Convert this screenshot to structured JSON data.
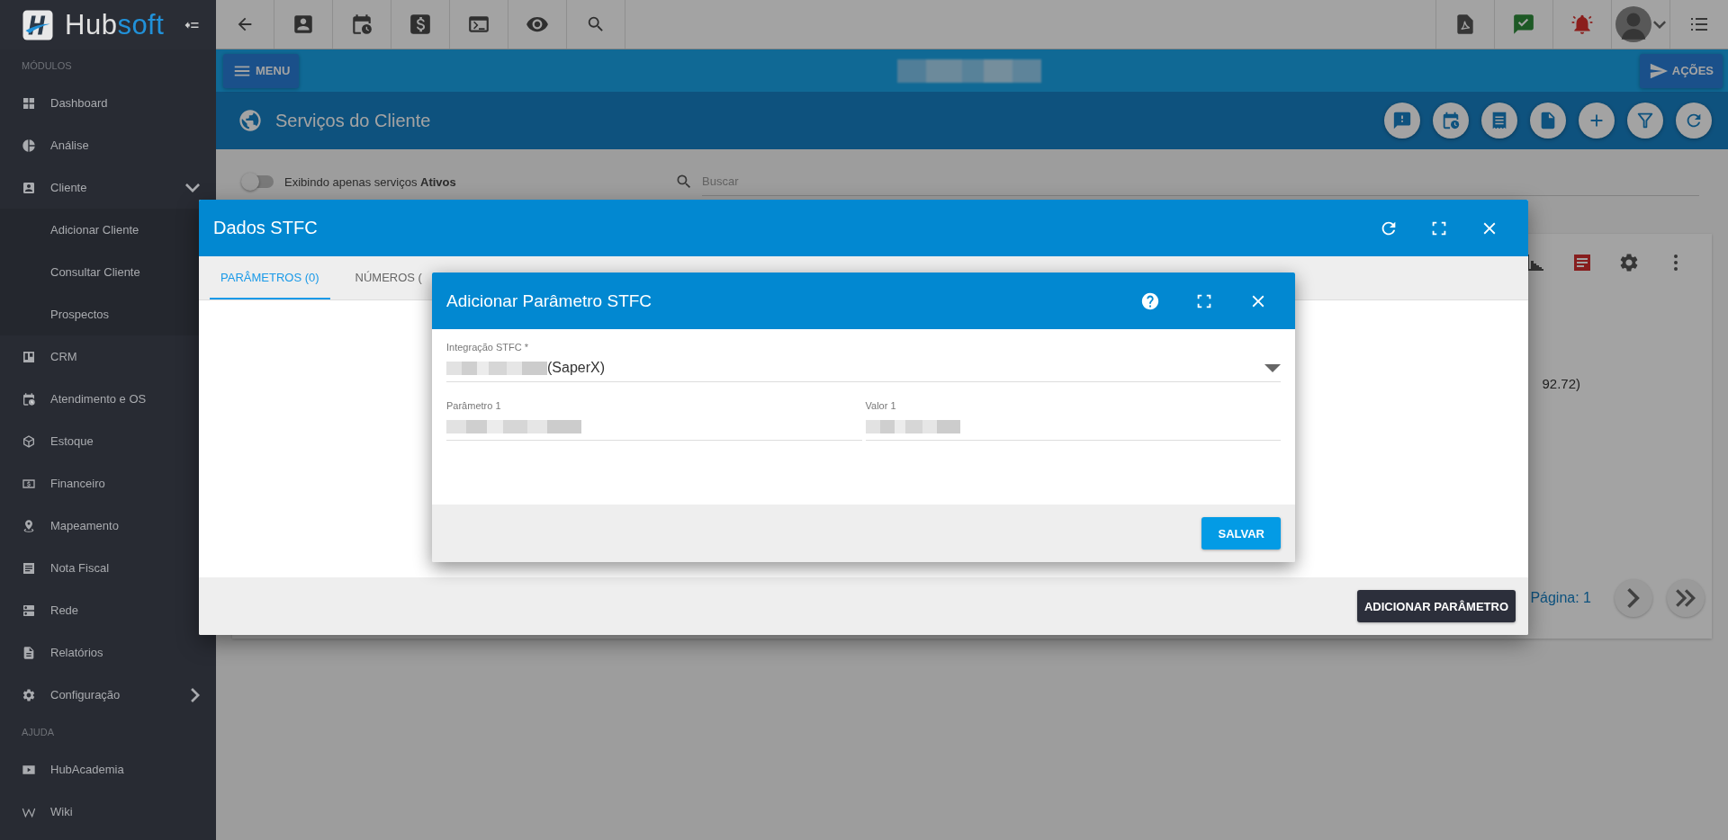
{
  "logo": {
    "lead": "Hub",
    "accent": "soft"
  },
  "sidebar": {
    "sections": [
      {
        "heading": "MÓDULOS",
        "items": [
          {
            "label": "Dashboard"
          },
          {
            "label": "Análise"
          },
          {
            "label": "Cliente",
            "expanded": true,
            "children": [
              {
                "label": "Adicionar Cliente"
              },
              {
                "label": "Consultar Cliente"
              },
              {
                "label": "Prospectos"
              }
            ]
          },
          {
            "label": "CRM"
          },
          {
            "label": "Atendimento e OS"
          },
          {
            "label": "Estoque"
          },
          {
            "label": "Financeiro"
          },
          {
            "label": "Mapeamento"
          },
          {
            "label": "Nota Fiscal"
          },
          {
            "label": "Rede"
          },
          {
            "label": "Relatórios"
          },
          {
            "label": "Configuração",
            "expanded": false
          }
        ]
      },
      {
        "heading": "AJUDA",
        "items": [
          {
            "label": "HubAcademia"
          },
          {
            "label": "Wiki"
          }
        ]
      }
    ]
  },
  "menu_bar": {
    "menu_button": "MENU",
    "actions_button": "AÇÕES"
  },
  "page_title": "Serviços do Cliente",
  "filter": {
    "text": "Exibindo apenas serviços **Ativos**",
    "on": false
  },
  "search": {
    "placeholder": "Buscar"
  },
  "card": {
    "partial_text": "92.72)",
    "pagination": "Página: 1"
  },
  "outer_dialog": {
    "title": "Dados STFC",
    "tabs": [
      {
        "label": "PARÂMETROS (0)",
        "selected": true
      },
      {
        "label": "NÚMEROS (",
        "selected": false
      }
    ],
    "footer_button": "ADICIONAR PARÂMETRO"
  },
  "inner_dialog": {
    "title": "Adicionar Parâmetro STFC",
    "select": {
      "label": "Integração STFC *",
      "value": "(SaperX)"
    },
    "fields": [
      {
        "label": "Parâmetro 1"
      },
      {
        "label": "Valor 1"
      }
    ],
    "save_button": "SALVAR"
  }
}
